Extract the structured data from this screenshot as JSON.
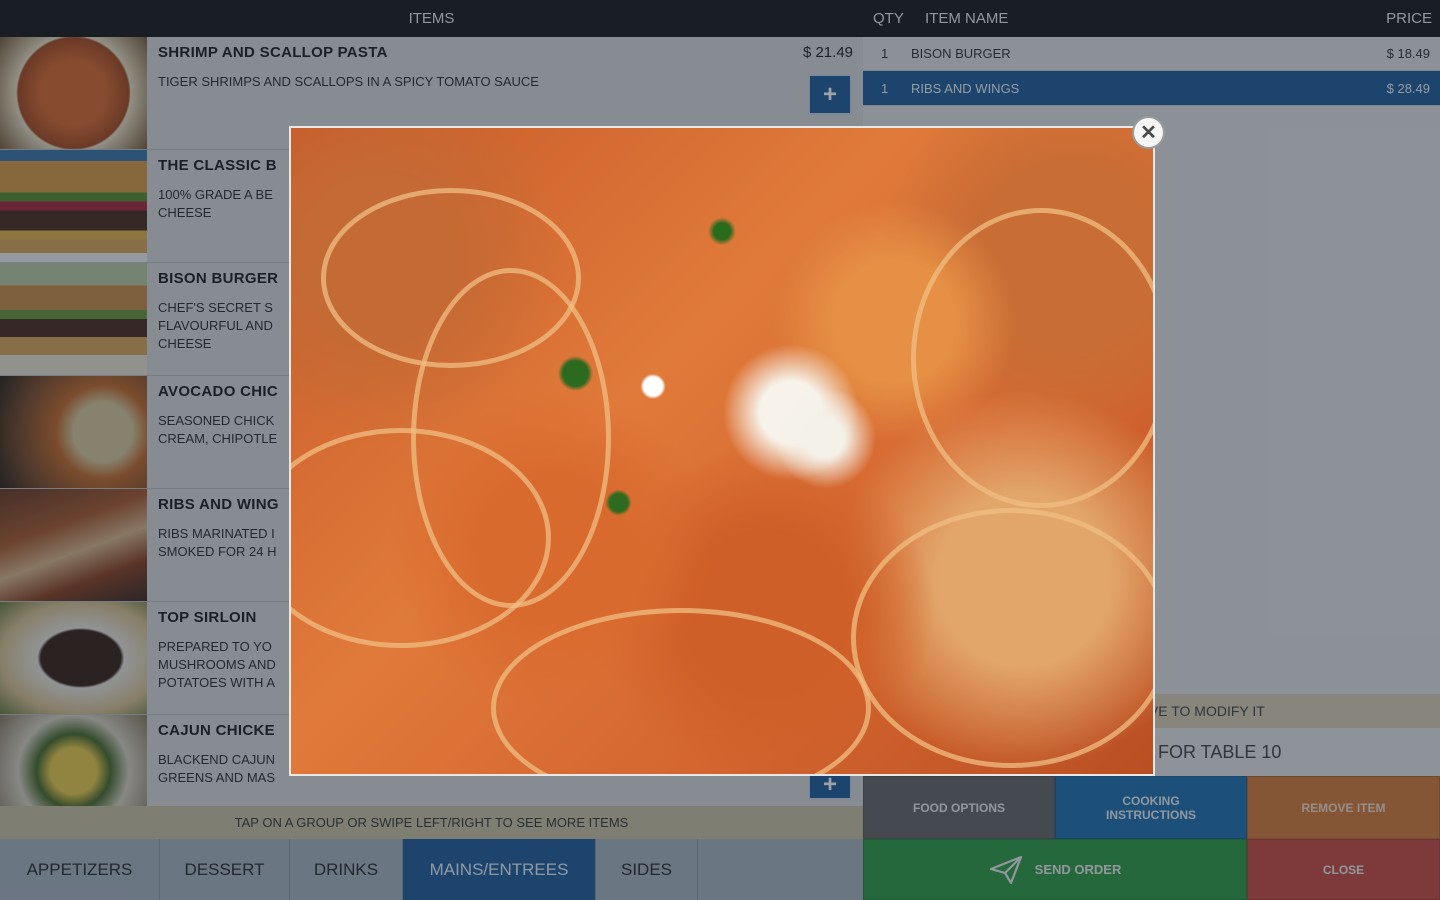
{
  "left_header": {
    "title": "ITEMS"
  },
  "items": [
    {
      "name": "SHRIMP AND SCALLOP PASTA",
      "desc": "TIGER SHRIMPS AND SCALLOPS IN A SPICY TOMATO SAUCE",
      "price": "$ 21.49"
    },
    {
      "name": "THE CLASSIC B",
      "desc": "100% GRADE A BE\nCHEESE",
      "price": ""
    },
    {
      "name": "BISON BURGER",
      "desc": "CHEF'S SECRET S\nFLAVOURFUL AND\nCHEESE",
      "price": ""
    },
    {
      "name": "AVOCADO CHIC",
      "desc": "SEASONED CHICK\nCREAM, CHIPOTLE",
      "price": ""
    },
    {
      "name": "RIBS AND WING",
      "desc": "RIBS MARINATED I\nSMOKED FOR 24 H",
      "price": ""
    },
    {
      "name": "TOP SIRLOIN",
      "desc": "PREPARED TO YO\nMUSHROOMS AND\nPOTATOES WITH A",
      "price": ""
    },
    {
      "name": "CAJUN CHICKE",
      "desc": "BLACKEND CAJUN\nGREENS AND MAS",
      "price": ""
    }
  ],
  "add_label": "+",
  "hint_text": "TAP ON A GROUP OR SWIPE LEFT/RIGHT TO SEE MORE ITEMS",
  "tabs": [
    {
      "label": "APPETIZERS",
      "active": false
    },
    {
      "label": "DESSERT",
      "active": false
    },
    {
      "label": "DRINKS",
      "active": false
    },
    {
      "label": "MAINS/ENTREES",
      "active": true
    },
    {
      "label": "SIDES",
      "active": false
    }
  ],
  "order_header": {
    "qty": "QTY",
    "name": "ITEM NAME",
    "price": "PRICE"
  },
  "order_rows": [
    {
      "qty": "1",
      "name": "BISON BURGER",
      "price": "$ 18.49",
      "selected": false
    },
    {
      "qty": "1",
      "name": "RIBS AND WINGS",
      "price": "$ 28.49",
      "selected": true
    }
  ],
  "modify_hint": "OVE TO MODIFY IT",
  "table_info": "FOR TABLE 10",
  "actions": {
    "food_options": "FOOD OPTIONS",
    "cooking_instructions": "COOKING\nINSTRUCTIONS",
    "remove_item": "REMOVE ITEM",
    "send_order": "SEND ORDER",
    "close": "CLOSE"
  },
  "close_icon": "close-icon",
  "colors": {
    "accent": "#1f5c98",
    "send": "#2f9a43",
    "close": "#c94a43",
    "remove": "#d27a38",
    "cook": "#1f6fae"
  }
}
